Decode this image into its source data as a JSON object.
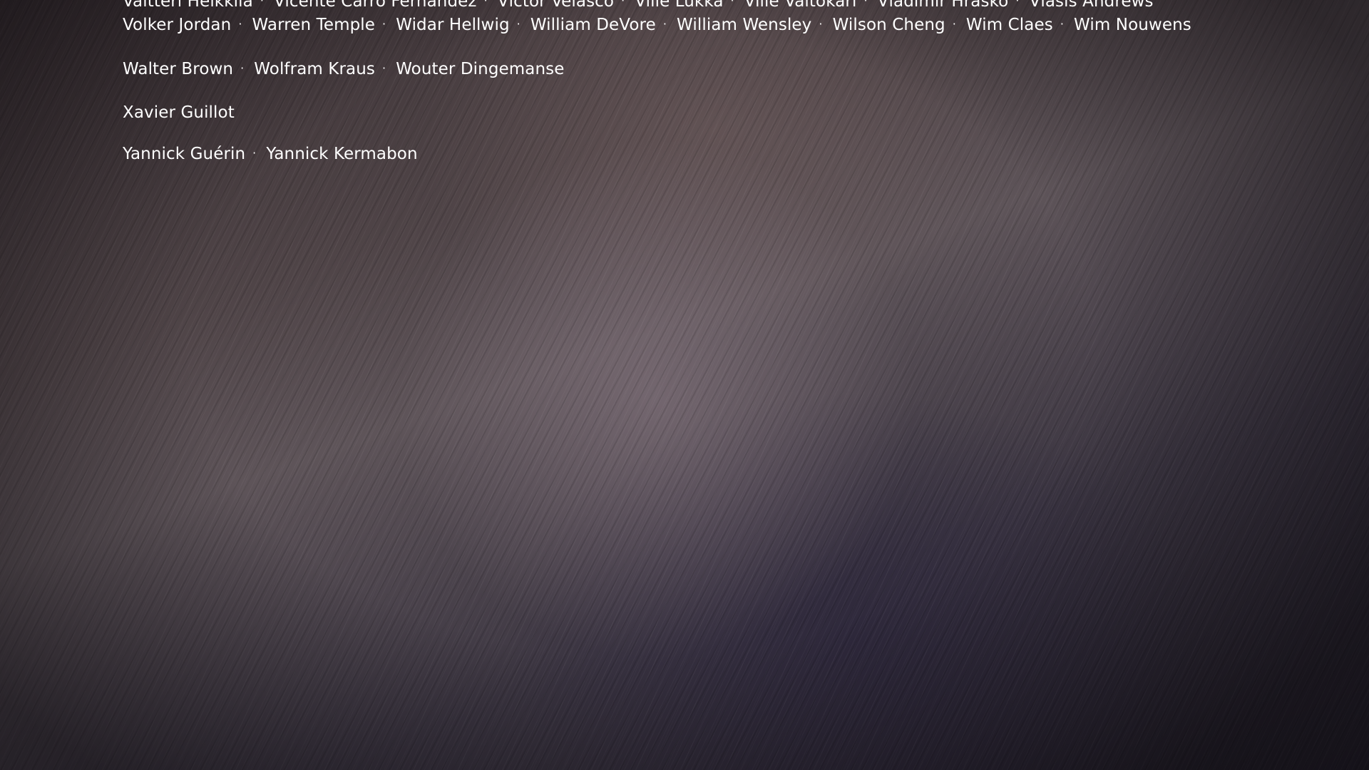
{
  "credits": {
    "rows": [
      [
        "Valtteri Heikkilä",
        "Vicente Carro Fernández",
        "Víctor Velasco",
        "Ville Lukka",
        "Ville Valtokari",
        "Vladimir Hraško",
        "Vlasis Andrews"
      ],
      [
        "Volker Jordan",
        "Warren Temple",
        "Widar Hellwig",
        "William DeVore",
        "William Wensley",
        "Wilson Cheng",
        "Wim Claes",
        "Wim Nouwens"
      ],
      [
        "Walter Brown",
        "Wolfram Kraus",
        "Wouter Dingemanse"
      ],
      [
        "Xavier Guillot"
      ],
      [
        "Yannick Guérin",
        "Yannick Kermabon"
      ]
    ],
    "separator": "·"
  },
  "colors": {
    "text": "#ffffff",
    "background_center": "#6e6268",
    "background_edge": "#221e29"
  }
}
